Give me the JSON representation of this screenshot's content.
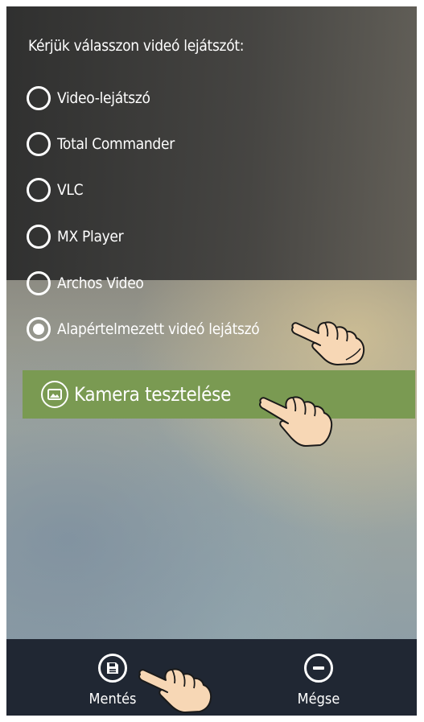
{
  "dialog": {
    "title": "Kérjük válasszon videó lejátszót:",
    "options": [
      {
        "label": "Video-lejátszó",
        "selected": false
      },
      {
        "label": "Total Commander",
        "selected": false
      },
      {
        "label": "VLC",
        "selected": false
      },
      {
        "label": "MX Player",
        "selected": false
      },
      {
        "label": "Archos Video",
        "selected": false
      },
      {
        "label": "Alapértelmezett videó lejátszó",
        "selected": true
      }
    ],
    "camera_button": {
      "label": "Kamera tesztelése",
      "icon": "image-icon"
    }
  },
  "bottom_bar": {
    "save": {
      "label": "Mentés",
      "icon": "save-icon"
    },
    "cancel": {
      "label": "Mégse",
      "icon": "minus-circle-icon"
    }
  },
  "colors": {
    "accent_green": "#7a9a52",
    "bottom_bar": "#202733",
    "text": "#ffffff"
  }
}
